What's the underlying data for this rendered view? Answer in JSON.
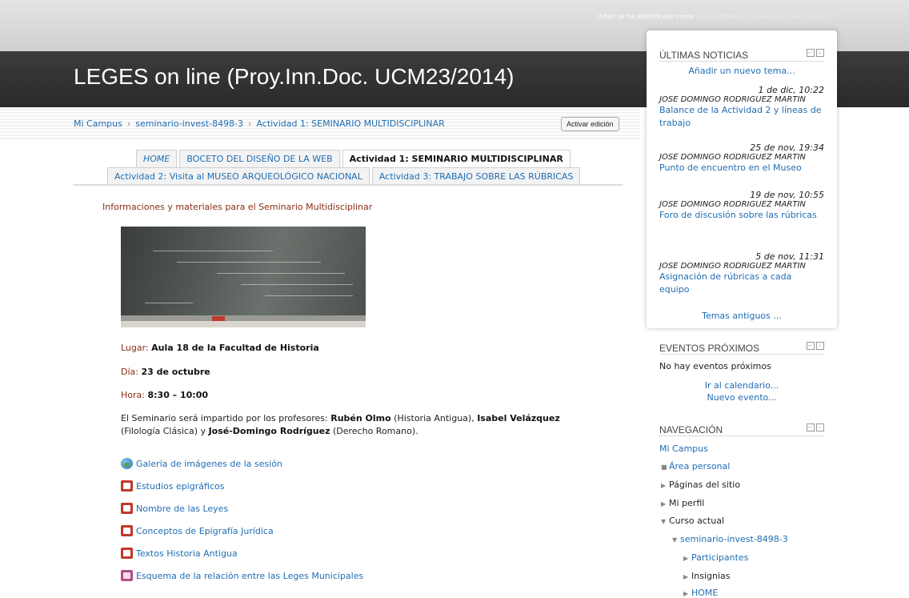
{
  "login": {
    "prefix": "Usted se ha identificado como",
    "user": "JOSE DOMINGO RODRIGUEZ MARTIN",
    "logout": "(Salir)"
  },
  "header": {
    "title": "LEGES on line (Proy.Inn.Doc. UCM23/2014)"
  },
  "breadcrumb": {
    "items": [
      "Mi Campus",
      "seminario-invest-8498-3",
      "Actividad 1: SEMINARIO MULTIDISCIPLINAR"
    ],
    "separator": "›"
  },
  "edit_button": "Activar edición",
  "tabs": {
    "row1": [
      "HOME",
      "BOCETO DEL DISEÑO DE LA WEB",
      "Actividad 1: SEMINARIO MULTIDISCIPLINAR"
    ],
    "row2": [
      "Actividad 2: Visita al MUSEO ARQUEOLÓGICO NACIONAL",
      "Actividad 3: TRABAJO SOBRE LAS RÚBRICAS"
    ],
    "active": "Actividad 1: SEMINARIO MULTIDISCIPLINAR"
  },
  "main": {
    "intro": "Informaciones y materiales para el Seminario Multidisciplinar",
    "lugar_label": "Lugar:",
    "lugar_value": "Aula 18 de la Facultad de Historia",
    "dia_label": "Día:",
    "dia_value": "23 de octubre",
    "hora_label": "Hora:",
    "hora_value": "8:30 – 10:00",
    "description": {
      "p1": "El Seminario será impartido por los profesores: ",
      "n1": "Rubén Olmo",
      "p2": " (Historia Antigua), ",
      "n2": "Isabel Velázquez",
      "p3": " (Filología Clásica) y ",
      "n3": "José-Domingo Rodríguez",
      "p4": " (Derecho Romano)."
    },
    "resources": [
      "Galería de imágenes de la sesión",
      "Estudios epigráficos",
      "Nombre de las Leyes",
      "Conceptos de Epigrafía Jurídica",
      "Textos Historia Antigua",
      "Esquema de la relación entre las Leges Municipales"
    ]
  },
  "sidebar": {
    "news": {
      "title": "ÚLTIMAS NOTICIAS",
      "add_topic": "Añadir un nuevo tema...",
      "items": [
        {
          "date": "1 de dic, 10:22",
          "author": "JOSE DOMINGO RODRIGUEZ MARTIN",
          "title": "Balance de la Actividad 2 y líneas de trabajo"
        },
        {
          "date": "25 de nov, 19:34",
          "author": "JOSE DOMINGO RODRIGUEZ MARTIN",
          "title": "Punto de encuentro en el Museo"
        },
        {
          "date": "19 de nov, 10:55",
          "author": "JOSE DOMINGO RODRIGUEZ MARTIN",
          "title": "Foro de discusión sobre las rúbricas"
        },
        {
          "date": "5 de nov, 11:31",
          "author": "JOSE DOMINGO RODRIGUEZ MARTIN",
          "title": "Asignación de rúbricas a cada equipo"
        }
      ],
      "older": "Temas antiguos ..."
    },
    "events": {
      "title": "EVENTOS PRÓXIMOS",
      "none": "No hay eventos próximos",
      "calendar": "Ir al calendario...",
      "new_event": "Nuevo evento..."
    },
    "navigation": {
      "title": "NAVEGACIÓN",
      "root": "Mi Campus",
      "area_personal": "Área personal",
      "paginas": "Páginas del sitio",
      "perfil": "Mi perfil",
      "curso_actual": "Curso actual",
      "course": "seminario-invest-8498-3",
      "participantes": "Participantes",
      "insignias": "Insignias",
      "home": "HOME"
    }
  },
  "colors": {
    "link": "#1f6db3",
    "banner": "#2f2f2f",
    "label_red": "#8a2d13"
  }
}
